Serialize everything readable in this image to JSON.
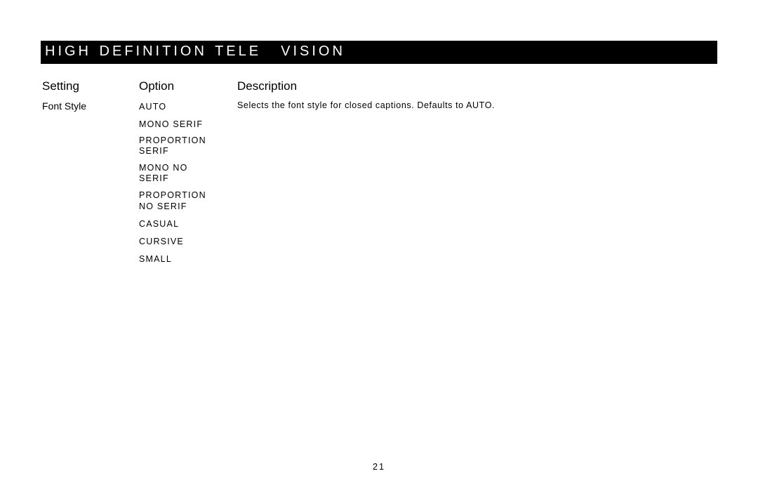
{
  "banner": {
    "part1": "HIGH DEFINITION TELE",
    "part2": "VISION"
  },
  "headers": {
    "setting": "Setting",
    "option": "Option",
    "description": "Description"
  },
  "row": {
    "setting": "Font Style",
    "options": {
      "o0": "AUTO",
      "o1": "MONO SERIF",
      "o2a": "PROPORTION",
      "o2b": "SERIF",
      "o3a": "MONO NO",
      "o3b": "SERIF",
      "o4a": "PROPORTION",
      "o4b": "NO SERIF",
      "o5": "CASUAL",
      "o6": "CURSIVE",
      "o7": "SMALL"
    },
    "description": "Selects the font style for closed captions. Defaults to AUTO."
  },
  "page_number": "21"
}
